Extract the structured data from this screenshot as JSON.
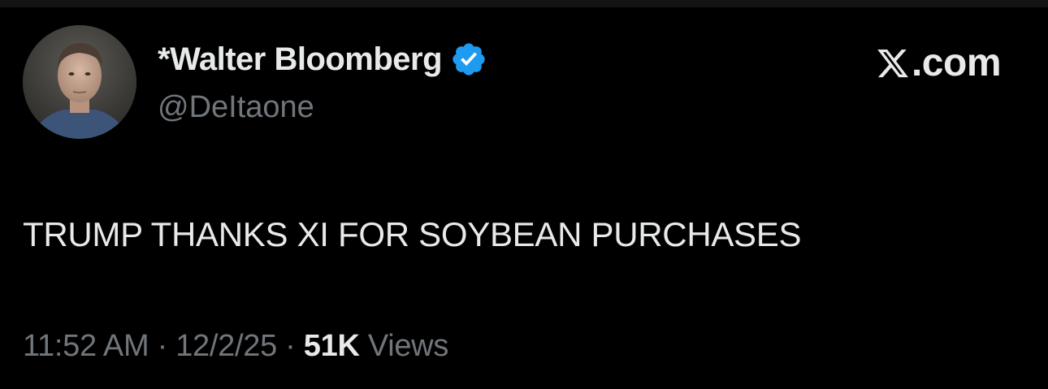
{
  "author": {
    "display_name": "*Walter Bloomberg",
    "handle": "@DeItaone",
    "verified": true
  },
  "brand": {
    "label": ".com",
    "logo_icon": "x-logo-icon"
  },
  "tweet": {
    "text": "TRUMP THANKS XI FOR SOYBEAN PURCHASES"
  },
  "meta": {
    "time": "11:52 AM",
    "separator_1": " · ",
    "date": "12/2/25",
    "separator_2": " · ",
    "views_count": "51K",
    "views_label": " Views"
  },
  "colors": {
    "background": "#000000",
    "primary_text": "#e7e9ea",
    "secondary_text": "#71767b",
    "verified_badge": "#1d9bf0"
  }
}
